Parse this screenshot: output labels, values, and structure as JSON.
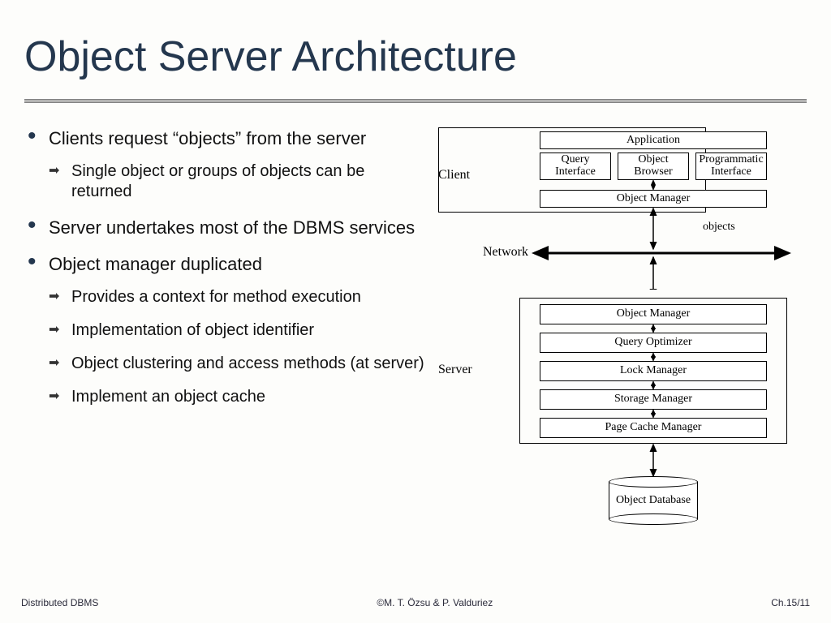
{
  "title": "Object Server Architecture",
  "bullets": [
    {
      "main": "Clients request “objects” from the server",
      "subs": [
        "Single object or groups of objects can be returned"
      ]
    },
    {
      "main": "Server undertakes most of the DBMS services",
      "subs": []
    },
    {
      "main": "Object manager duplicated",
      "subs": [
        "Provides a context for method execution",
        "Implementation of object identifier",
        "Object clustering and access methods (at server)",
        "Implement an object cache"
      ]
    }
  ],
  "diagram": {
    "client_label": "Client",
    "server_label": "Server",
    "network_label": "Network",
    "objects_label": "objects",
    "client_top": {
      "app": "Application",
      "qi": "Query Interface",
      "ob": "Object Browser",
      "pi": "Programmatic Interface"
    },
    "client_om": "Object Manager",
    "server_boxes": {
      "om": "Object Manager",
      "qo": "Query Optimizer",
      "lm": "Lock Manager",
      "sm": "Storage Manager",
      "pcm": "Page Cache Manager"
    },
    "db": "Object Database"
  },
  "footer": {
    "left": "Distributed DBMS",
    "center": "©M. T. Özsu & P. Valduriez",
    "right": "Ch.15/11"
  }
}
